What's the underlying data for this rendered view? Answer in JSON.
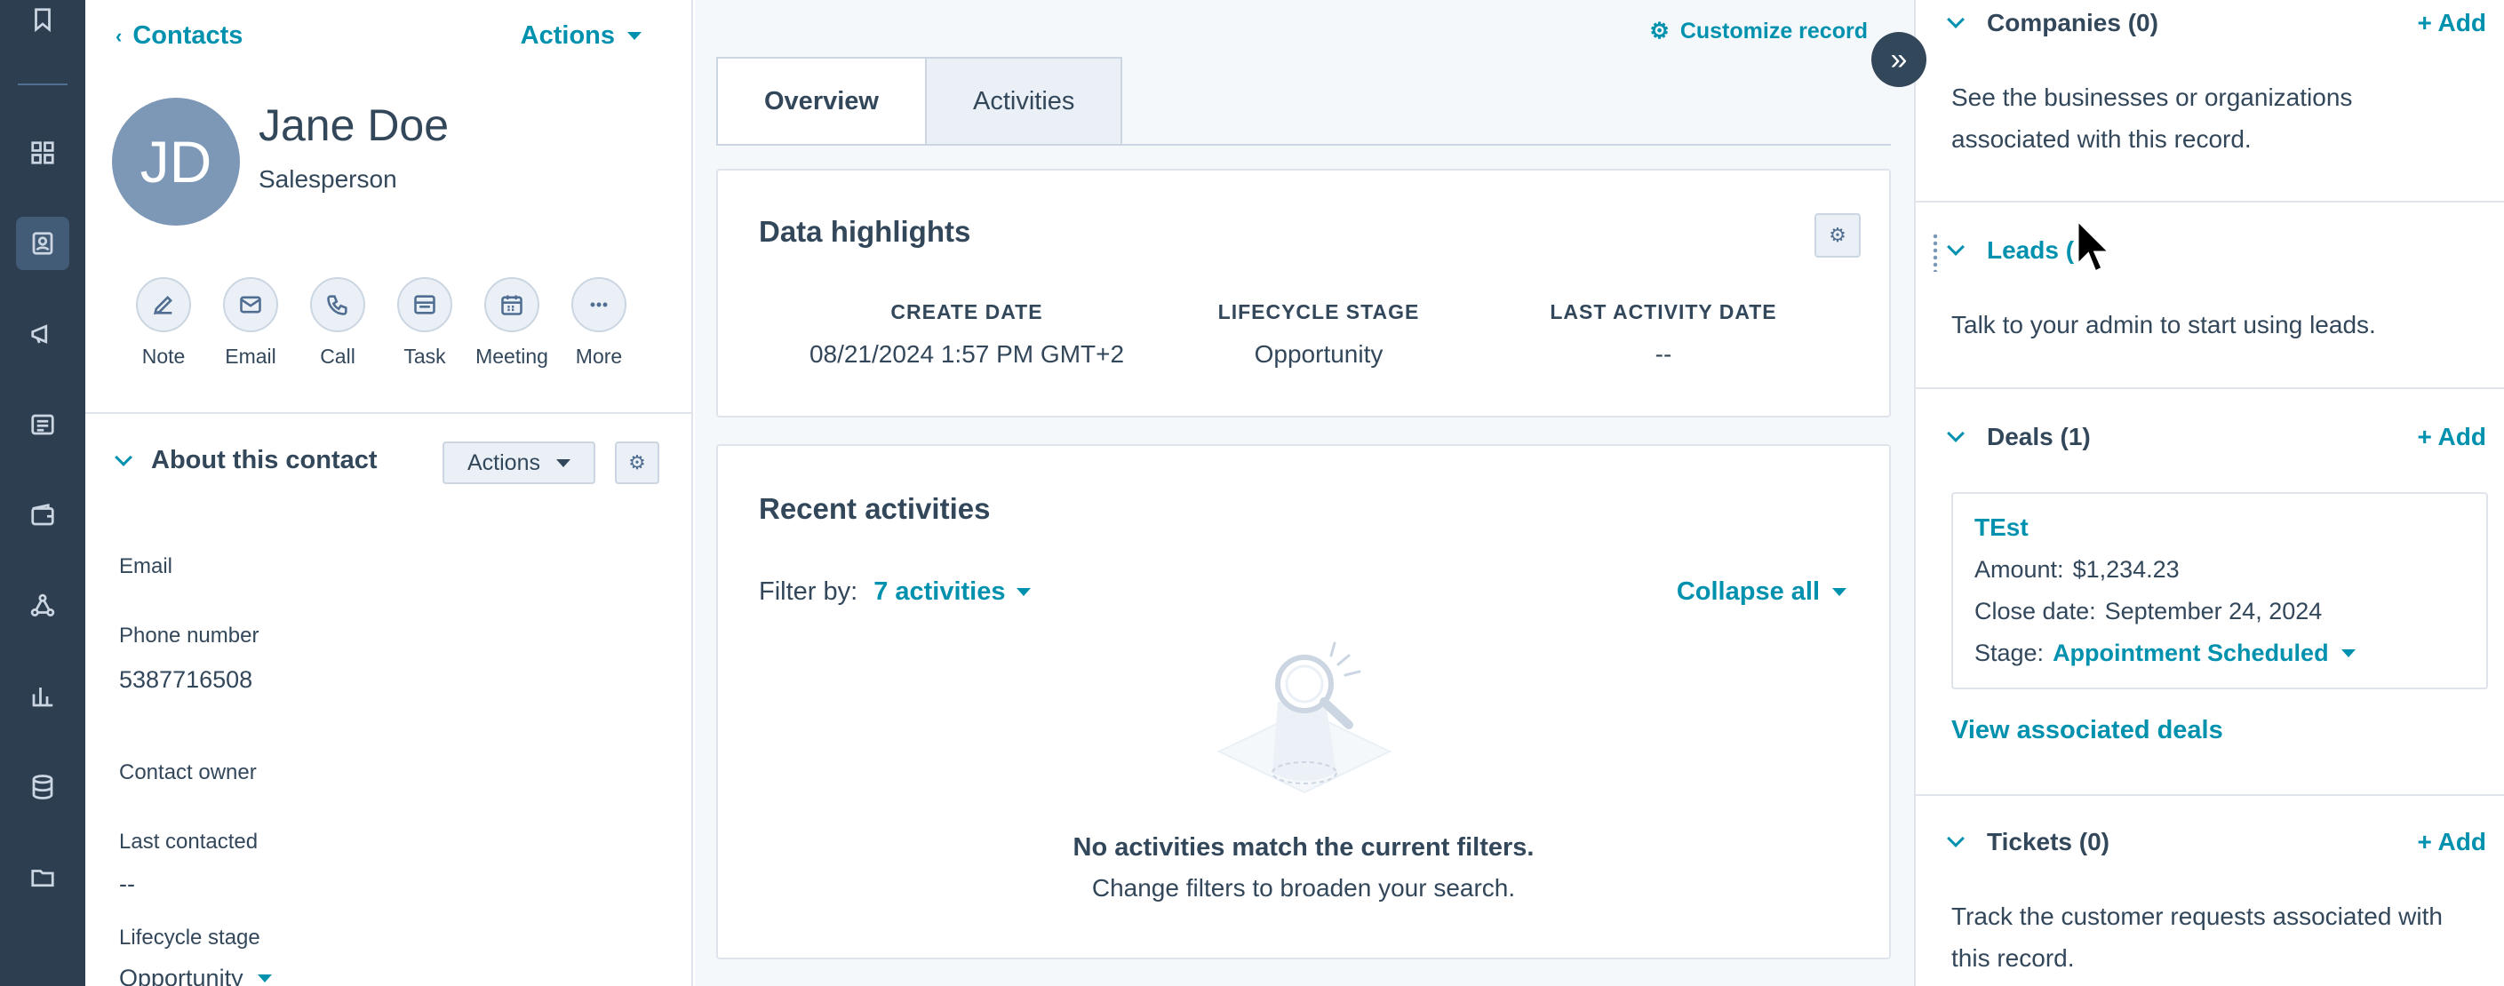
{
  "nav": {
    "icons": [
      "bookmark-icon",
      "grid-icon",
      "contacts-icon",
      "megaphone-icon",
      "content-icon",
      "commerce-icon",
      "automation-icon",
      "reports-icon",
      "data-icon",
      "library-icon"
    ]
  },
  "contact": {
    "back_label": "Contacts",
    "actions_label": "Actions",
    "initials": "JD",
    "name": "Jane Doe",
    "role": "Salesperson",
    "quick_actions": [
      {
        "label": "Note",
        "icon": "pencil-icon"
      },
      {
        "label": "Email",
        "icon": "envelope-icon"
      },
      {
        "label": "Call",
        "icon": "phone-icon"
      },
      {
        "label": "Task",
        "icon": "task-icon"
      },
      {
        "label": "Meeting",
        "icon": "calendar-icon"
      },
      {
        "label": "More",
        "icon": "more-icon"
      }
    ],
    "about": {
      "title": "About this contact",
      "actions_label": "Actions",
      "properties": {
        "email_label": "Email",
        "phone_label": "Phone number",
        "phone_value": "5387716508",
        "owner_label": "Contact owner",
        "last_contacted_label": "Last contacted",
        "last_contacted_value": "--",
        "lifecycle_label": "Lifecycle stage",
        "lifecycle_value": "Opportunity"
      }
    }
  },
  "main": {
    "customize_label": "Customize record",
    "tabs": [
      {
        "label": "Overview",
        "active": true
      },
      {
        "label": "Activities",
        "active": false
      }
    ],
    "highlights": {
      "title": "Data highlights",
      "items": [
        {
          "label": "CREATE DATE",
          "value": "08/21/2024 1:57 PM GMT+2"
        },
        {
          "label": "LIFECYCLE STAGE",
          "value": "Opportunity"
        },
        {
          "label": "LAST ACTIVITY DATE",
          "value": "--"
        }
      ]
    },
    "recent": {
      "title": "Recent activities",
      "filter_label": "Filter by:",
      "filter_value": "7 activities",
      "collapse_label": "Collapse all",
      "empty_title": "No activities match the current filters.",
      "empty_sub": "Change filters to broaden your search."
    }
  },
  "sidebar": {
    "companies": {
      "title": "Companies (0)",
      "add": "+ Add",
      "text": "See the businesses or organizations associated with this record."
    },
    "leads": {
      "title": "Leads (",
      "text": "Talk to your admin to start using leads."
    },
    "deals": {
      "title": "Deals (1)",
      "add": "+ Add",
      "deal_name": "TEst",
      "amount_label": "Amount:",
      "amount_value": "$1,234.23",
      "close_label": "Close date:",
      "close_value": "September 24, 2024",
      "stage_label": "Stage:",
      "stage_value": "Appointment Scheduled",
      "view_all": "View associated deals"
    },
    "tickets": {
      "title": "Tickets (0)",
      "add": "+ Add",
      "text": "Track the customer requests associated with this record."
    }
  },
  "colors": {
    "rail": "#2d3e50",
    "accent": "#0091ae",
    "text": "#33475b",
    "avatar": "#7c98b6"
  }
}
